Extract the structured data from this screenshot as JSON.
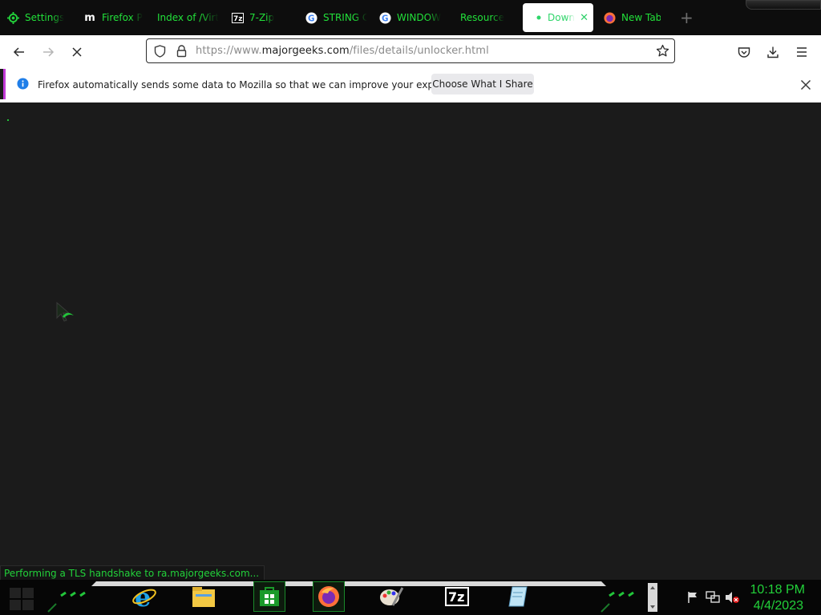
{
  "tabs": [
    {
      "label": "Settings",
      "icon": "gear-icon",
      "active": false
    },
    {
      "label": "Firefox P",
      "icon": "m-logo-icon",
      "active": false
    },
    {
      "label": "Index of /Virt",
      "icon": "",
      "active": false
    },
    {
      "label": "7-Zip",
      "icon": "7zip-icon",
      "active": false
    },
    {
      "label": "STRING C",
      "icon": "google-icon",
      "active": false
    },
    {
      "label": "WINDOW",
      "icon": "google-icon",
      "active": false
    },
    {
      "label": "Resource",
      "icon": "",
      "active": false
    },
    {
      "label": "Downl",
      "icon": "loading-dot-icon",
      "active": true
    },
    {
      "label": "New Tab",
      "icon": "firefox-icon",
      "active": false
    }
  ],
  "navbar": {
    "url_prefix": "https://www.",
    "url_domain": "majorgeeks.com",
    "url_path": "/files/details/unlocker.html"
  },
  "notification": {
    "message": "Firefox automatically sends some data to Mozilla so that we can improve your experience.",
    "button_label": "Choose What I Share"
  },
  "status": {
    "text": "Performing a TLS handshake to ra.majorgeeks.com..."
  },
  "clock": {
    "time": "10:18 PM",
    "date": "4/4/2023"
  },
  "taskbar_items": [
    {
      "name": "internet-explorer-icon"
    },
    {
      "name": "file-explorer-icon"
    },
    {
      "name": "store-icon"
    },
    {
      "name": "firefox-icon"
    },
    {
      "name": "paint-icon"
    },
    {
      "name": "7zip-icon"
    },
    {
      "name": "notepad-icon"
    }
  ],
  "colors": {
    "accent": "#22d13a",
    "page_bg": "#1b1b1b",
    "notif_border": "#c23ad6"
  }
}
